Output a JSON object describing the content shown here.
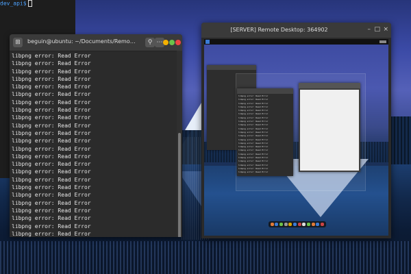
{
  "background_terminal": {
    "prompt": "dev_api$"
  },
  "terminal": {
    "title": "beguin@ubuntu: ~/Documents/Remote-Desktop-on-Python",
    "new_tab_icon": "new-tab-icon",
    "lines": [
      "libpng error: Read Error",
      "libpng error: Read Error",
      "libpng error: Read Error",
      "libpng error: Read Error",
      "libpng error: Read Error",
      "libpng error: Read Error",
      "libpng error: Read Error",
      "libpng error: Read Error",
      "libpng error: Read Error",
      "libpng error: Read Error",
      "libpng error: Read Error",
      "libpng error: Read Error",
      "libpng error: Read Error",
      "libpng error: Read Error",
      "libpng error: Read Error",
      "libpng error: Read Error",
      "libpng error: Read Error",
      "libpng error: Read Error",
      "libpng error: Read Error",
      "libpng error: Read Error",
      "libpng error: Read Error",
      "libpng error: Read Error",
      "libpng error: Read Error",
      "libpng error: Read Error"
    ],
    "colors": {
      "minimize": "#f5b100",
      "maximize": "#6cc24a",
      "close": "#ee4444"
    }
  },
  "remote_desktop": {
    "title": "[SERVER] Remote Desktop: 364902",
    "min_glyph": "–",
    "max_glyph": "□",
    "close_glyph": "×",
    "nested_windows": {
      "terminal_small_lines": [
        "libpng error: Read Error",
        "libpng error: Read Error",
        "libpng error: Read Error",
        "libpng error: Read Error",
        "libpng error: Read Error",
        "libpng error: Read Error",
        "libpng error: Read Error",
        "libpng error: Read Error",
        "libpng error: Read Error",
        "libpng error: Read Error",
        "libpng error: Read Error",
        "libpng error: Read Error",
        "libpng error: Read Error",
        "libpng error: Read Error",
        "libpng error: Read Error",
        "libpng error: Read Error",
        "libpng error: Read Error",
        "libpng error: Read Error",
        "libpng error: Read Error",
        "libpng error: Read Error",
        "libpng error: Read Error",
        "libpng error: Read Error"
      ]
    },
    "dock_colors": [
      "#e07b39",
      "#3a7bd5",
      "#6cc24a",
      "#999999",
      "#d9a400",
      "#3a7bd5",
      "#cc4444",
      "#dddddd",
      "#6cc24a",
      "#e07b39",
      "#3a7bd5",
      "#cc4444"
    ]
  }
}
